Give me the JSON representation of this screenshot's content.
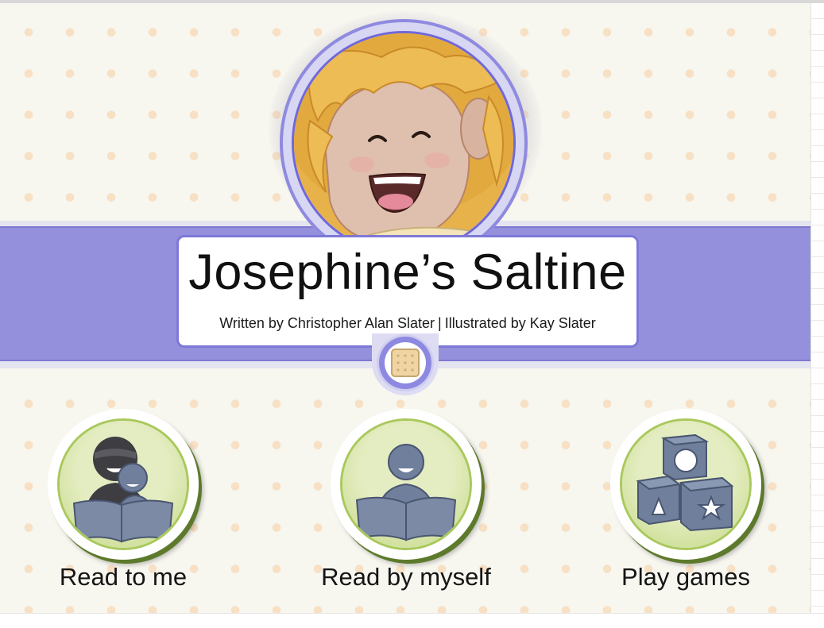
{
  "book": {
    "title": "Josephine’s Saltine",
    "author_credit": "Written by Christopher Alan Slater",
    "separator": "|",
    "illustrator_credit": "Illustrated by Kay Slater"
  },
  "portrait": {
    "icon": "josephine-portrait-icon"
  },
  "badge": {
    "icon": "saltine-cracker-icon"
  },
  "choices": [
    {
      "label": "Read to me",
      "icon": "parent-and-child-reading-icon"
    },
    {
      "label": "Read by myself",
      "icon": "child-reading-icon"
    },
    {
      "label": "Play games",
      "icon": "toy-blocks-icon"
    }
  ],
  "colors": {
    "banner": "#9490dc",
    "banner_border": "#7d78d0",
    "button_disc": "#d8e6a8",
    "button_shadow": "#5d7a2c",
    "icon_blue": "#6f7f9c",
    "background": "#f7f6ef"
  }
}
